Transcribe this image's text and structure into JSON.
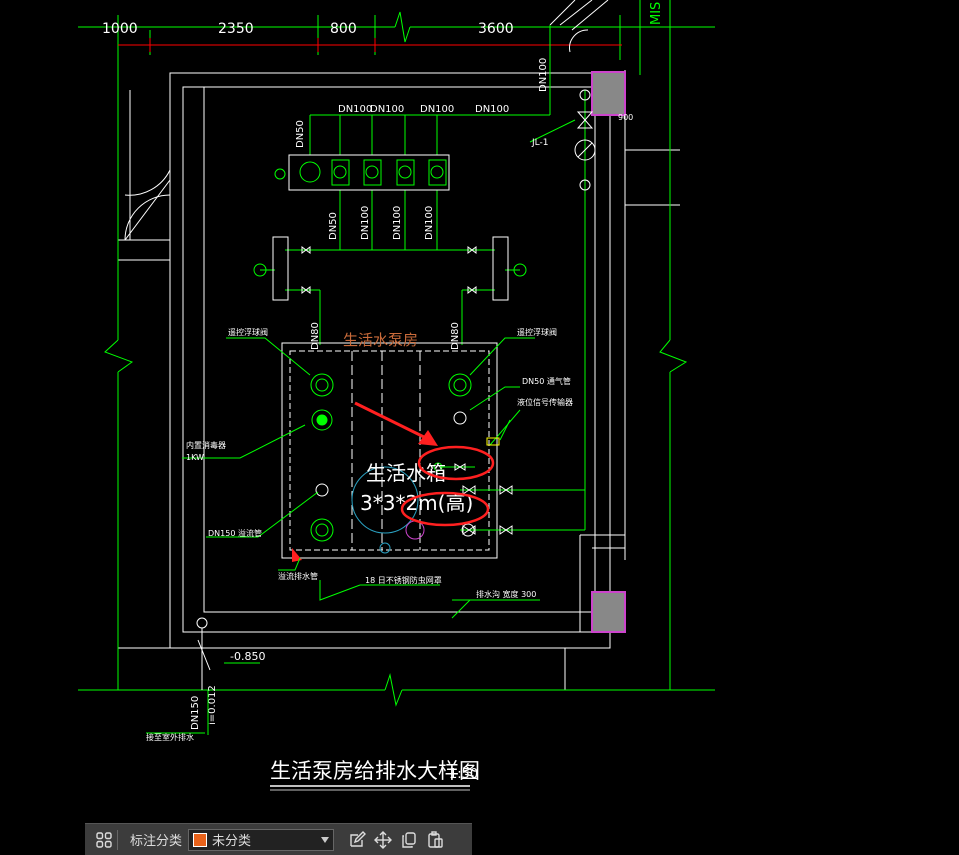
{
  "dimensions": [
    "1000",
    "2350",
    "800",
    "3600"
  ],
  "room_label": "生活水泵房",
  "tank_label_line1": "生活水箱",
  "tank_label_line2": "3*3*2m(高)",
  "title": "生活泵房给排水大样图",
  "scale": "1:50",
  "pipe_labels": {
    "dn100_a": "DN100",
    "dn100_b": "DN100",
    "dn100_c": "DN100",
    "dn100_d": "DN100",
    "dn100_e": "DN100",
    "dn50_top": "DN50",
    "dn50_low": "DN50",
    "dn100_low_a": "DN100",
    "dn100_low_b": "DN100",
    "dn100_low_c": "DN100",
    "dn80_left": "DN80",
    "dn80_right": "DN80",
    "dn150": "DN150",
    "slope": "i=0.012"
  },
  "annotations": {
    "jl": "JL-1",
    "float_left": "遥控浮球阀",
    "float_right": "遥控浮球阀",
    "vent": "DN50 通气管",
    "overflow_pipe": "DN150 溢流管",
    "liquid_level": "液位信号传输器",
    "heater": "内置消毒器",
    "heater_power": "1KW",
    "drain_pipe": "溢流排水管",
    "gate": "18 日不锈钢防虫网罩",
    "trench": "排水沟 宽度 300",
    "elevation": "-0.850",
    "outlet": "接至室外排水",
    "dim_left": "900"
  },
  "side_text": "MIS",
  "toolbar": {
    "label": "标注分类",
    "selected": "未分类"
  },
  "colors": {
    "green": "#00ff00",
    "white": "#ffffff",
    "red": "#ff0000",
    "magenta": "#cc44cc",
    "orange": "#e8621a"
  }
}
